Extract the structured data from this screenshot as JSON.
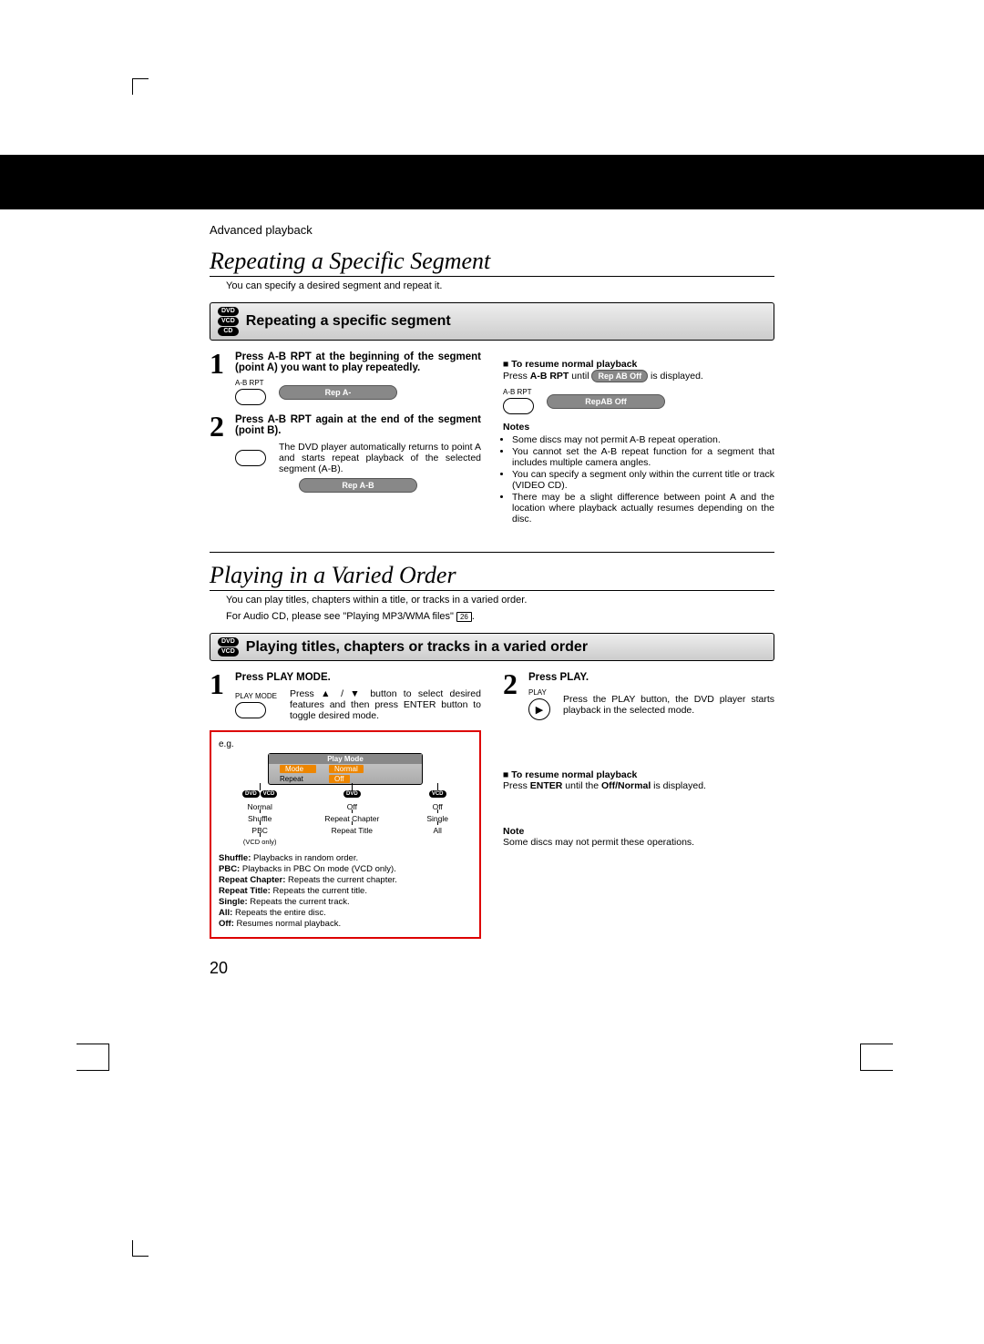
{
  "breadcrumb": "Advanced playback",
  "page_number": "20",
  "page_ref": "26",
  "sec_repeat": {
    "title": "Repeating a Specific Segment",
    "subtitle": "You can specify a desired segment and repeat it.",
    "heading": "Repeating a specific segment",
    "media": [
      "DVD",
      "VCD",
      "CD"
    ],
    "step1": {
      "num": "1",
      "title": "Press A-B RPT at the beginning of the segment (point A) you want to play repeatedly.",
      "btn_label": "A-B RPT",
      "osd": "Rep  A-"
    },
    "step2": {
      "num": "2",
      "title": "Press A-B RPT again at the end of the segment (point B).",
      "desc": "The DVD player automatically returns to point A and starts repeat playback of the selected segment (A-B).",
      "osd": "Rep  A-B"
    },
    "resume": {
      "heading": "To resume normal playback",
      "text_pre": "Press ",
      "text_bold": "A-B RPT",
      "text_mid": " until ",
      "osd_inline": "Rep AB Off",
      "text_post": "  is displayed.",
      "btn_label": "A-B RPT",
      "osd": "RepAB Off"
    },
    "notes_heading": "Notes",
    "notes": [
      "Some discs may not permit A-B repeat operation.",
      "You cannot set the A-B repeat function for a segment that includes multiple camera angles.",
      "You can specify a segment only within the current title or track (VIDEO CD).",
      "There may be a slight difference between point A and the location where playback actually resumes depending on the disc."
    ]
  },
  "sec_varied": {
    "title": "Playing in a Varied Order",
    "subtitle": "You can play titles, chapters within a title, or tracks in a varied order.",
    "audio_note": "For Audio CD, please see \"Playing MP3/WMA files\" ",
    "heading": "Playing titles, chapters or tracks in a varied order",
    "media": [
      "DVD",
      "VCD"
    ],
    "step1": {
      "num": "1",
      "title": "Press PLAY MODE.",
      "btn_label": "PLAY MODE",
      "desc_pre": "Press ",
      "desc_mid": " button to select desired features and then press ENTER button to toggle desired mode."
    },
    "step2": {
      "num": "2",
      "title": "Press PLAY.",
      "btn_label": "PLAY",
      "desc": "Press the PLAY button, the DVD player starts playback in the selected mode."
    },
    "resume": {
      "heading": "To resume normal playback",
      "text_pre": "Press ",
      "text_bold": "ENTER",
      "text_mid": " until the ",
      "text_bold2": "Off/Normal",
      "text_post": " is displayed."
    },
    "note_heading": "Note",
    "note": "Some discs may not permit these operations.",
    "playmode": {
      "box_title": "Play Mode",
      "row1_label": "Mode",
      "row1_val": "Normal",
      "row2_label": "Repeat",
      "row2_val": "Off",
      "eg": "e.g.",
      "tree": {
        "col1_media": [
          "DVD",
          "VCD"
        ],
        "col1": [
          "Normal",
          "Shuffle",
          "PBC",
          "(VCD only)"
        ],
        "col2_media": [
          "DVD"
        ],
        "col2": [
          "Off",
          "Repeat Chapter",
          "Repeat Title"
        ],
        "col3_media": [
          "VCD"
        ],
        "col3": [
          "Off",
          "Single",
          "All"
        ]
      },
      "defs": [
        {
          "k": "Shuffle:",
          "v": " Playbacks in random order."
        },
        {
          "k": "PBC:",
          "v": " Playbacks in PBC On mode (VCD only)."
        },
        {
          "k": "Repeat Chapter:",
          "v": " Repeats the current chapter."
        },
        {
          "k": "Repeat Title:",
          "v": " Repeats the current title."
        },
        {
          "k": "Single:",
          "v": " Repeats the current track."
        },
        {
          "k": "All:",
          "v": " Repeats the entire disc."
        },
        {
          "k": "Off:",
          "v": " Resumes normal playback."
        }
      ]
    }
  }
}
